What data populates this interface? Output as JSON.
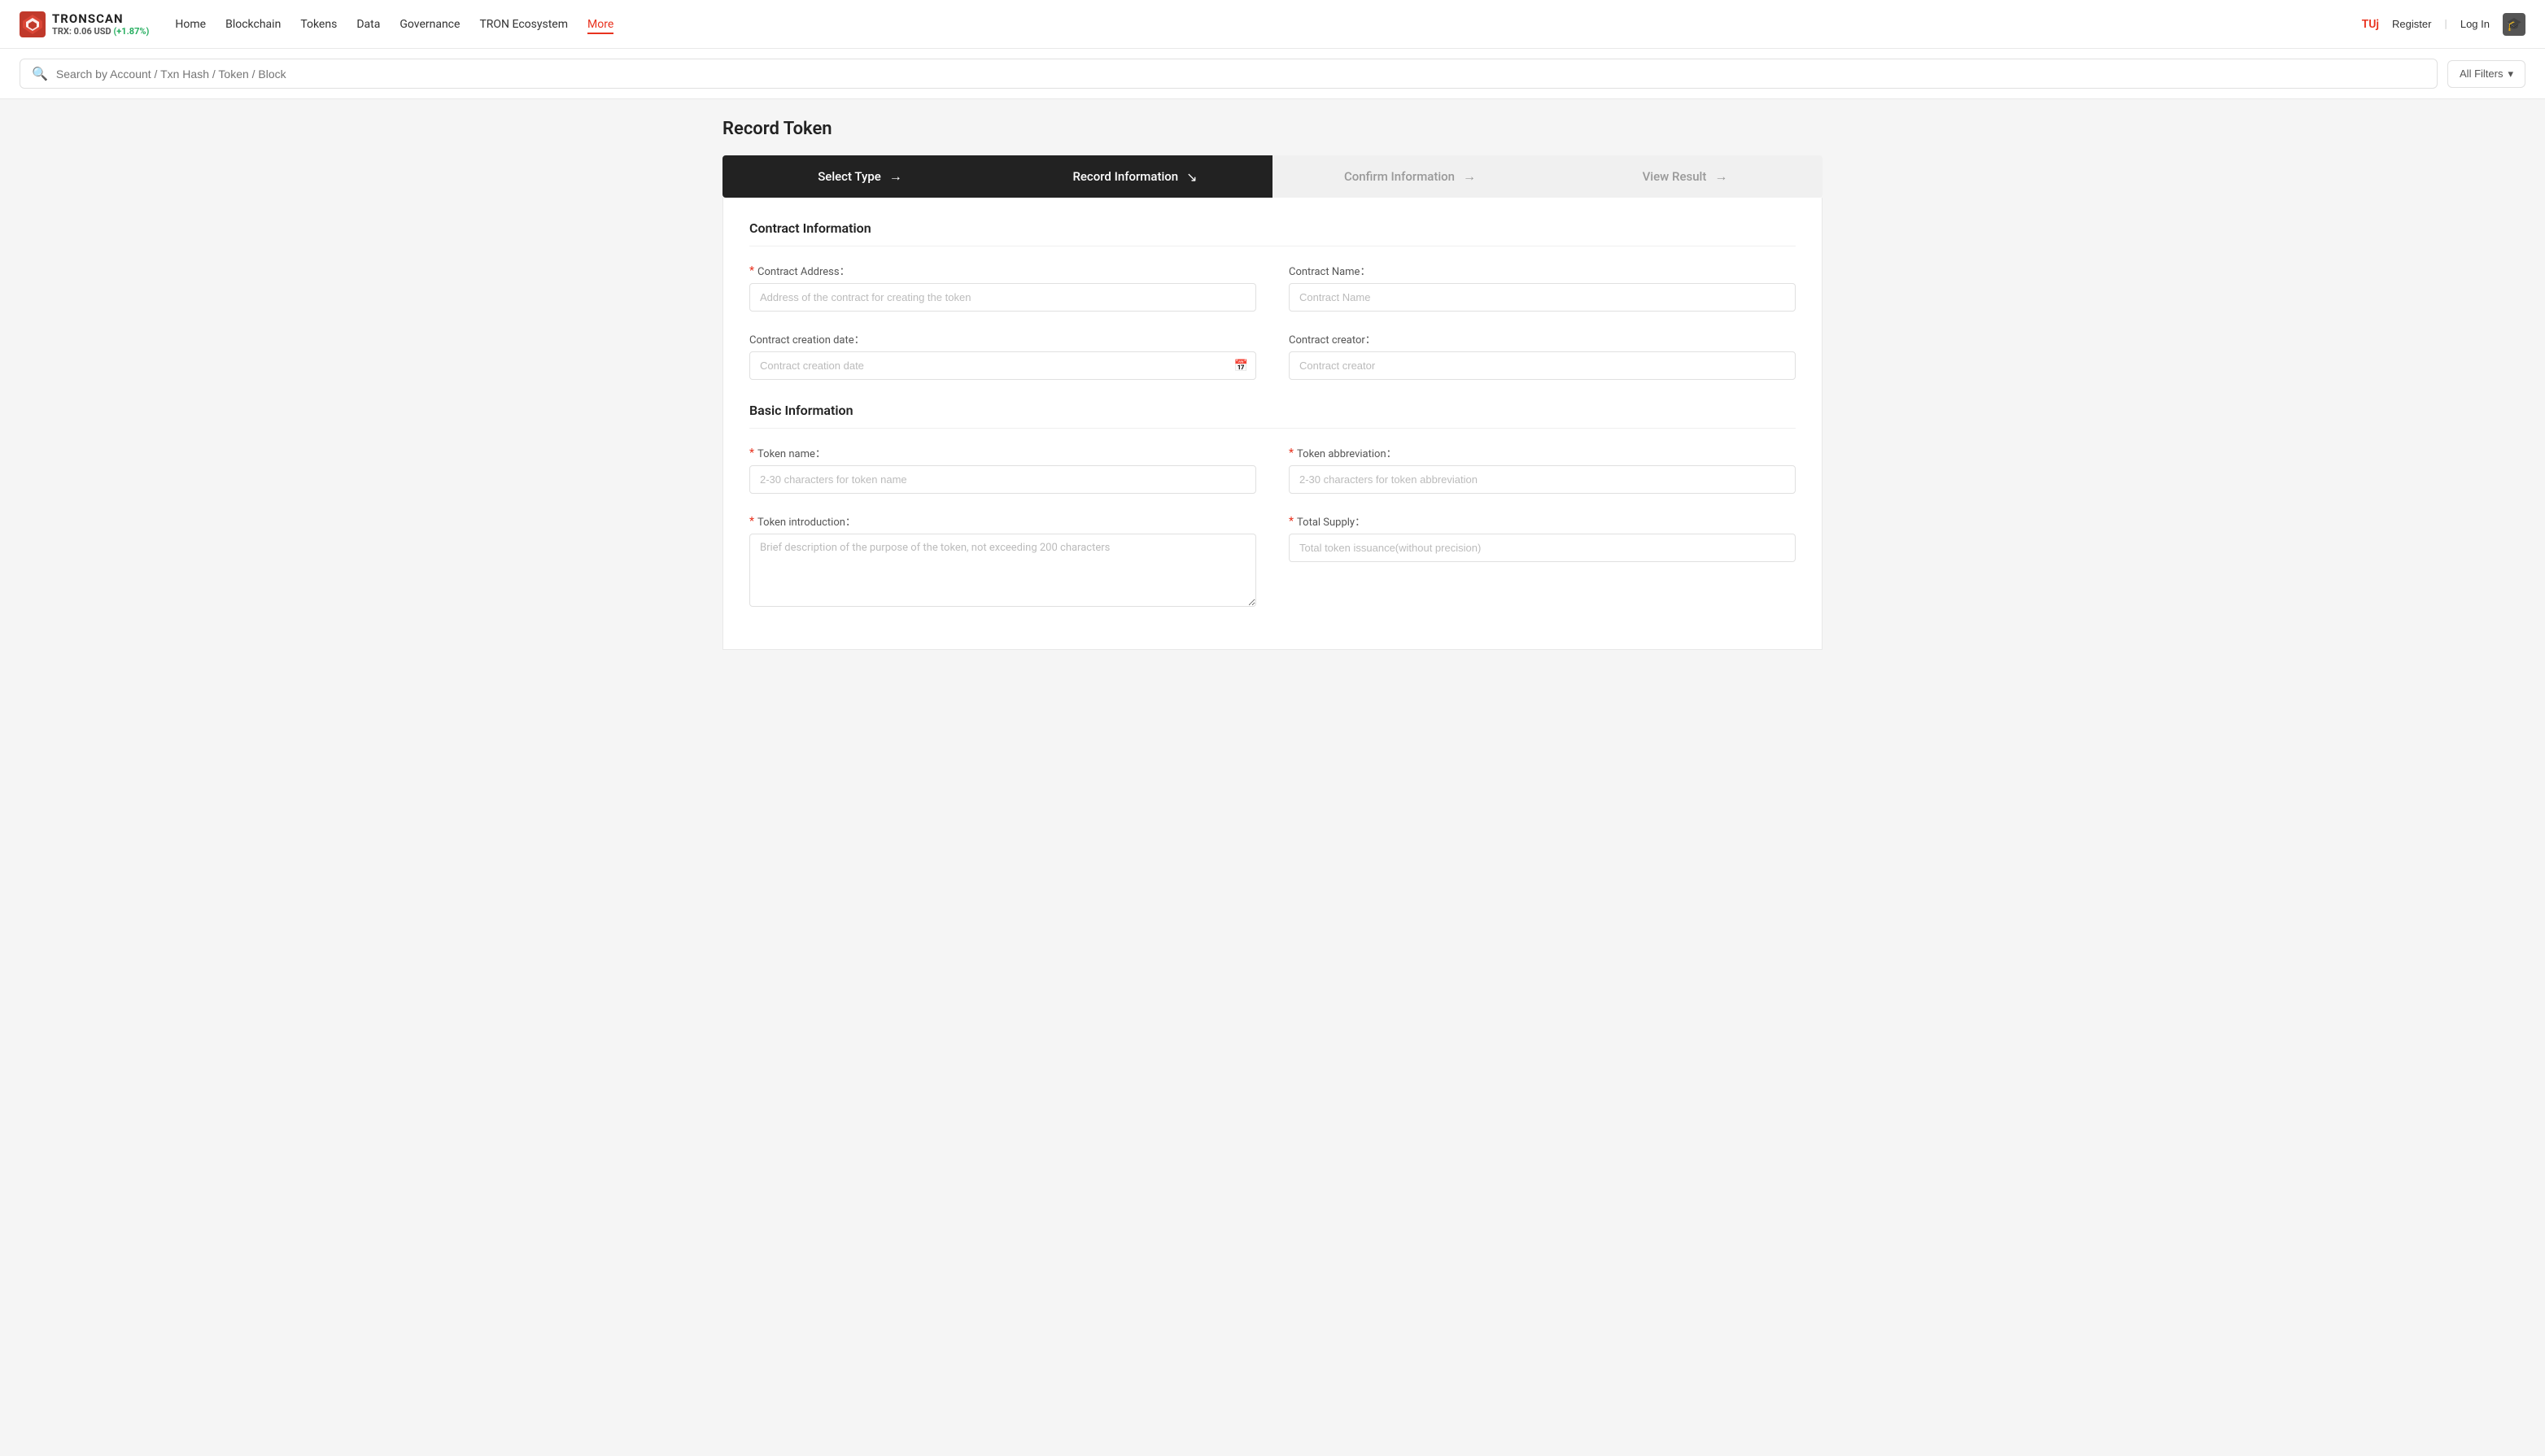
{
  "logo": {
    "name": "TRONSCAN",
    "trx_label": "TRX: 0.06 USD",
    "trx_change": "(+1.87%)"
  },
  "nav": {
    "items": [
      {
        "label": "Home",
        "active": false
      },
      {
        "label": "Blockchain",
        "active": false
      },
      {
        "label": "Tokens",
        "active": false
      },
      {
        "label": "Data",
        "active": false
      },
      {
        "label": "Governance",
        "active": false
      },
      {
        "label": "TRON Ecosystem",
        "active": false
      },
      {
        "label": "More",
        "active": true
      }
    ]
  },
  "header_right": {
    "user_label": "TUj",
    "register_label": "Register",
    "login_label": "Log In"
  },
  "search": {
    "placeholder": "Search by Account / Txn Hash / Token / Block",
    "filters_label": "All Filters"
  },
  "page": {
    "title": "Record Token"
  },
  "steps": [
    {
      "label": "Select Type",
      "arrow": "→",
      "state": "active"
    },
    {
      "label": "Record Information",
      "arrow": "↘",
      "state": "active"
    },
    {
      "label": "Confirm Information",
      "arrow": "→",
      "state": "inactive"
    },
    {
      "label": "View Result",
      "arrow": "→",
      "state": "inactive"
    }
  ],
  "contract_section": {
    "title": "Contract Information",
    "fields": [
      {
        "label": "Contract Address：",
        "required": true,
        "type": "input",
        "placeholder": "Address of the contract for creating the token",
        "name": "contract-address"
      },
      {
        "label": "Contract Name：",
        "required": false,
        "type": "input",
        "placeholder": "Contract Name",
        "name": "contract-name"
      },
      {
        "label": "Contract creation date：",
        "required": false,
        "type": "date",
        "placeholder": "Contract creation date",
        "name": "contract-creation-date"
      },
      {
        "label": "Contract creator：",
        "required": false,
        "type": "input",
        "placeholder": "Contract creator",
        "name": "contract-creator"
      }
    ]
  },
  "basic_section": {
    "title": "Basic Information",
    "fields": [
      {
        "label": "Token name：",
        "required": true,
        "type": "input",
        "placeholder": "2-30 characters for token name",
        "name": "token-name"
      },
      {
        "label": "Token abbreviation：",
        "required": true,
        "type": "input",
        "placeholder": "2-30 characters for token abbreviation",
        "name": "token-abbreviation"
      },
      {
        "label": "Token introduction：",
        "required": true,
        "type": "textarea",
        "placeholder": "Brief description of the purpose of the token, not exceeding 200 characters",
        "name": "token-introduction"
      },
      {
        "label": "Total Supply：",
        "required": true,
        "type": "input",
        "placeholder": "Total token issuance(without precision)",
        "name": "total-supply"
      }
    ]
  }
}
